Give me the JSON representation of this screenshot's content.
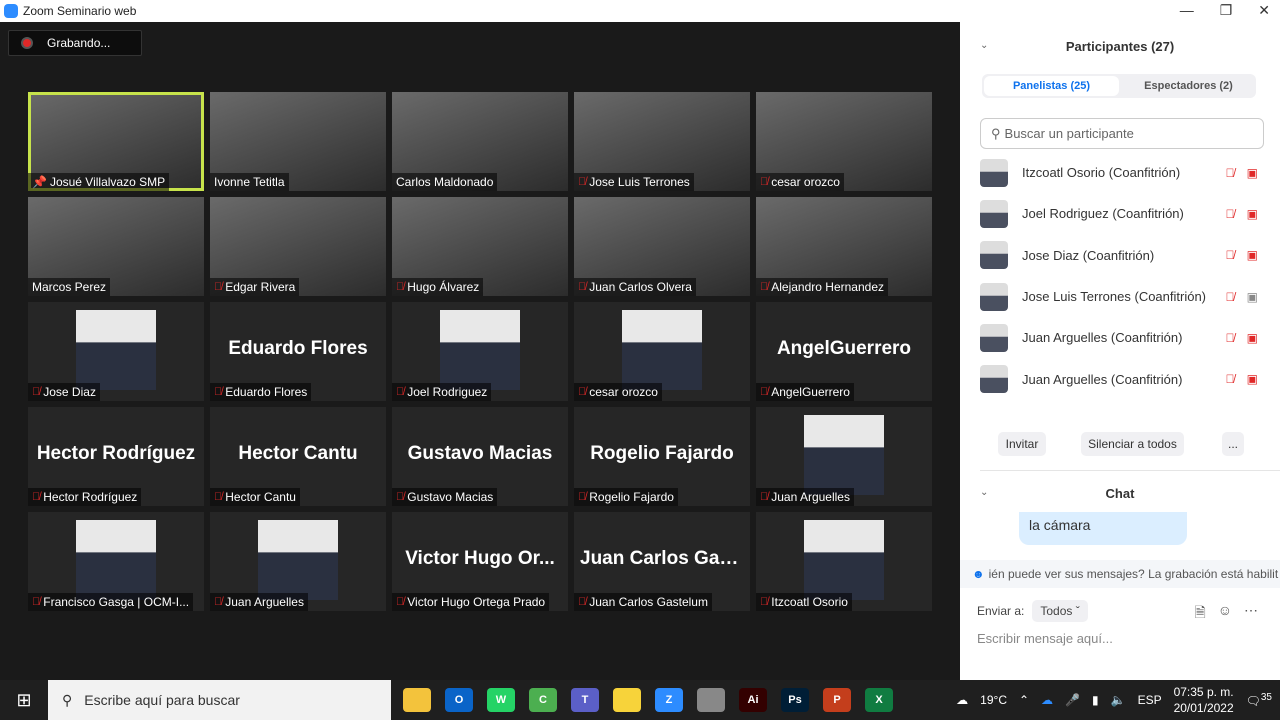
{
  "window": {
    "title": "Zoom Seminario web"
  },
  "recording": {
    "label": "Grabando..."
  },
  "tiles": [
    {
      "name": "Josué Villalvazo SMP",
      "kind": "video",
      "muted": false,
      "pinned": true,
      "highlight": true
    },
    {
      "name": "Ivonne Tetitla",
      "kind": "video",
      "muted": false
    },
    {
      "name": "Carlos Maldonado",
      "kind": "video",
      "muted": false
    },
    {
      "name": "Jose Luis Terrones",
      "kind": "video",
      "muted": true
    },
    {
      "name": "cesar orozco",
      "kind": "video",
      "muted": true
    },
    {
      "name": "Marcos Perez",
      "kind": "video",
      "muted": false
    },
    {
      "name": "Edgar Rivera",
      "kind": "video",
      "muted": true
    },
    {
      "name": "Hugo Álvarez",
      "kind": "video",
      "muted": true
    },
    {
      "name": "Juan Carlos Olvera",
      "kind": "video",
      "muted": true
    },
    {
      "name": "Alejandro Hernandez",
      "kind": "video",
      "muted": true
    },
    {
      "name": "Jose Diaz",
      "kind": "photo",
      "muted": true
    },
    {
      "name": "Eduardo Flores",
      "kind": "name",
      "big": "Eduardo Flores",
      "muted": true
    },
    {
      "name": "Joel Rodriguez",
      "kind": "photo",
      "muted": true
    },
    {
      "name": "cesar orozco",
      "kind": "photo",
      "muted": true
    },
    {
      "name": "AngelGuerrero",
      "kind": "name",
      "big": "AngelGuerrero",
      "muted": true
    },
    {
      "name": "Hector Rodríguez",
      "kind": "name",
      "big": "Hector Rodríguez",
      "muted": true
    },
    {
      "name": "Hector Cantu",
      "kind": "name",
      "big": "Hector Cantu",
      "muted": true
    },
    {
      "name": "Gustavo Macias",
      "kind": "name",
      "big": "Gustavo Macias",
      "muted": true
    },
    {
      "name": "Rogelio Fajardo",
      "kind": "name",
      "big": "Rogelio Fajardo",
      "muted": true
    },
    {
      "name": "Juan Arguelles",
      "kind": "photo",
      "muted": true
    },
    {
      "name": "Francisco Gasga | OCM-I...",
      "kind": "photo",
      "muted": true
    },
    {
      "name": "Juan Arguelles",
      "kind": "photo",
      "muted": true
    },
    {
      "name": "Victor Hugo Ortega Prado",
      "kind": "name",
      "big": "Victor Hugo Or...",
      "muted": true
    },
    {
      "name": "Juan Carlos Gastelum",
      "kind": "name",
      "big": "Juan Carlos Gas...",
      "muted": true
    },
    {
      "name": "Itzcoatl Osorio",
      "kind": "photo",
      "muted": true
    }
  ],
  "participants": {
    "title": "Participantes (27)",
    "tabs": [
      "Panelistas (25)",
      "Espectadores (2)"
    ],
    "search_placeholder": "Buscar un participante",
    "items": [
      {
        "name": "Itzcoatl Osorio (Coanfitrión)",
        "video": false
      },
      {
        "name": "Joel Rodriguez (Coanfitrión)",
        "video": false
      },
      {
        "name": "Jose Diaz (Coanfitrión)",
        "video": false
      },
      {
        "name": "Jose Luis Terrones (Coanfitrión)",
        "video": true
      },
      {
        "name": "Juan Arguelles (Coanfitrión)",
        "video": false
      },
      {
        "name": "Juan Arguelles (Coanfitrión)",
        "video": false
      }
    ],
    "invite": "Invitar",
    "mute_all": "Silenciar a todos",
    "more": "..."
  },
  "chat": {
    "title": "Chat",
    "message": "la cámara",
    "notice": "ién puede ver sus mensajes? La grabación está habilit",
    "send_to_label": "Enviar a:",
    "send_to_value": "Todos",
    "input_placeholder": "Escribir mensaje aquí..."
  },
  "taskbar": {
    "search_placeholder": "Escribe aquí para buscar",
    "apps": [
      {
        "label": "",
        "color": "#f3c33c"
      },
      {
        "label": "O",
        "color": "#0a64c8"
      },
      {
        "label": "W",
        "color": "#25d366"
      },
      {
        "label": "C",
        "color": "#4caf50"
      },
      {
        "label": "T",
        "color": "#5b5fc7"
      },
      {
        "label": "",
        "color": "#f7d33a"
      },
      {
        "label": "Z",
        "color": "#2d8cff"
      },
      {
        "label": "",
        "color": "#888"
      },
      {
        "label": "Ai",
        "color": "#330000"
      },
      {
        "label": "Ps",
        "color": "#001e36"
      },
      {
        "label": "P",
        "color": "#c43e1c"
      },
      {
        "label": "X",
        "color": "#107c41"
      }
    ],
    "temperature": "19°C",
    "language": "ESP",
    "time": "07:35 p. m.",
    "date": "20/01/2022",
    "notifications": "35"
  }
}
